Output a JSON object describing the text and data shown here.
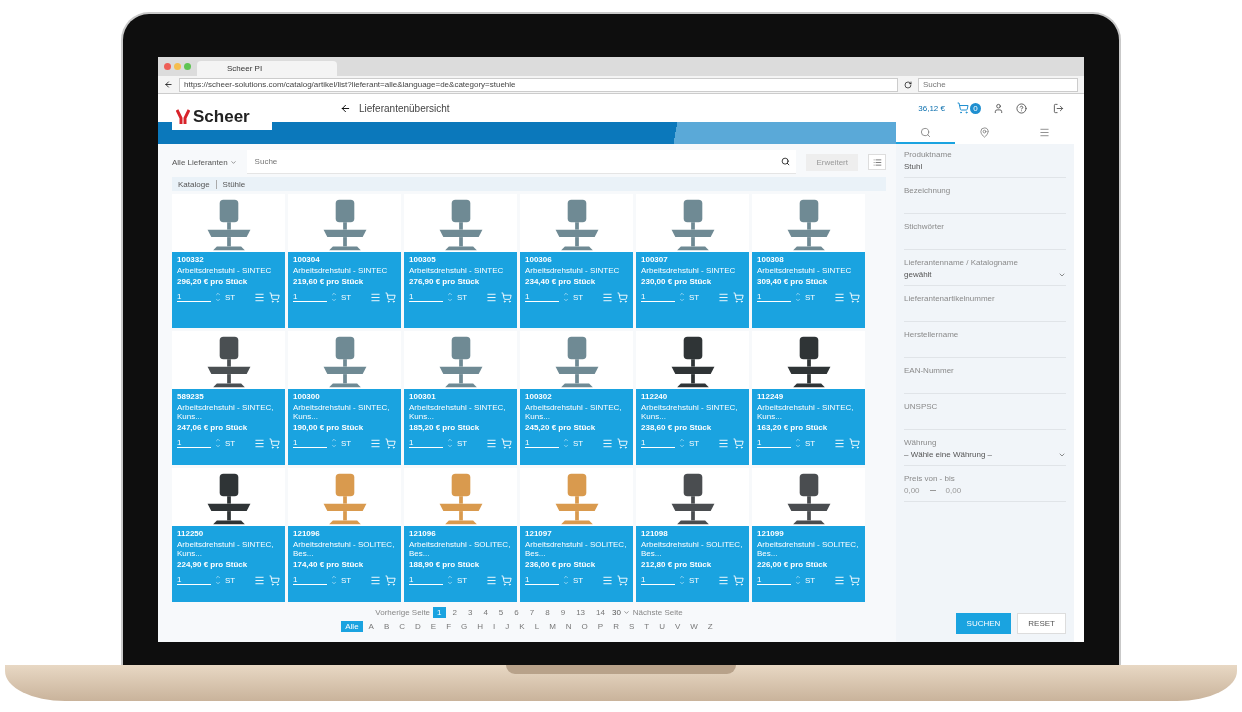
{
  "browser": {
    "tab_title": "Scheer PI",
    "url": "https://scheer-solutions.com/catalog/artikel/list?lieferant=alle&language=de&category=stuehle",
    "search_placeholder": "Suche"
  },
  "header": {
    "logo": "Scheer",
    "title": "Lieferantenübersicht",
    "cart_total": "36,12 €",
    "cart_count": "0"
  },
  "toolbar": {
    "supplier_filter": "Alle Lieferanten",
    "search_placeholder": "Suche",
    "action": "Erweitert"
  },
  "breadcrumb": [
    "Kataloge",
    "Stühle"
  ],
  "products": [
    {
      "id": "100332",
      "name": "Arbeitsdrehstuhl - SINTEC",
      "price": "296,20 € pro Stück",
      "qty": "1",
      "unit": "ST",
      "color": "#6f8a94"
    },
    {
      "id": "100304",
      "name": "Arbeitsdrehstuhl - SINTEC",
      "price": "219,60 € pro Stück",
      "qty": "1",
      "unit": "ST",
      "color": "#6f8a94"
    },
    {
      "id": "100305",
      "name": "Arbeitsdrehstuhl - SINTEC",
      "price": "276,90 € pro Stück",
      "qty": "1",
      "unit": "ST",
      "color": "#6f8a94"
    },
    {
      "id": "100306",
      "name": "Arbeitsdrehstuhl - SINTEC",
      "price": "234,40 € pro Stück",
      "qty": "1",
      "unit": "ST",
      "color": "#6f8a94"
    },
    {
      "id": "100307",
      "name": "Arbeitsdrehstuhl - SINTEC",
      "price": "230,00 € pro Stück",
      "qty": "1",
      "unit": "ST",
      "color": "#6f8a94"
    },
    {
      "id": "100308",
      "name": "Arbeitsdrehstuhl - SINTEC",
      "price": "309,40 € pro Stück",
      "qty": "1",
      "unit": "ST",
      "color": "#6f8a94"
    },
    {
      "id": "589235",
      "name": "Arbeitsdrehstuhl - SINTEC, Kuns...",
      "price": "247,06 € pro Stück",
      "qty": "1",
      "unit": "ST",
      "color": "#4a4f52"
    },
    {
      "id": "100300",
      "name": "Arbeitsdrehstuhl - SINTEC, Kuns...",
      "price": "190,00 € pro Stück",
      "qty": "1",
      "unit": "ST",
      "color": "#6f8a94"
    },
    {
      "id": "100301",
      "name": "Arbeitsdrehstuhl - SINTEC, Kuns...",
      "price": "185,20 € pro Stück",
      "qty": "1",
      "unit": "ST",
      "color": "#6f8a94"
    },
    {
      "id": "100302",
      "name": "Arbeitsdrehstuhl - SINTEC, Kuns...",
      "price": "245,20 € pro Stück",
      "qty": "1",
      "unit": "ST",
      "color": "#6f8a94"
    },
    {
      "id": "112240",
      "name": "Arbeitsdrehstuhl - SINTEC, Kuns...",
      "price": "238,60 € pro Stück",
      "qty": "1",
      "unit": "ST",
      "color": "#2f3436"
    },
    {
      "id": "112249",
      "name": "Arbeitsdrehstuhl - SINTEC, Kuns...",
      "price": "163,20 € pro Stück",
      "qty": "1",
      "unit": "ST",
      "color": "#2f3436"
    },
    {
      "id": "112250",
      "name": "Arbeitsdrehstuhl - SINTEC, Kuns...",
      "price": "224,90 € pro Stück",
      "qty": "1",
      "unit": "ST",
      "color": "#2f3436"
    },
    {
      "id": "121096",
      "name": "Arbeitsdrehstuhl - SOLITEC, Bes...",
      "price": "174,40 € pro Stück",
      "qty": "1",
      "unit": "ST",
      "color": "#d99a4e"
    },
    {
      "id": "121096",
      "name": "Arbeitsdrehstuhl - SOLITEC, Bes...",
      "price": "188,90 € pro Stück",
      "qty": "1",
      "unit": "ST",
      "color": "#d99a4e"
    },
    {
      "id": "121097",
      "name": "Arbeitsdrehstuhl - SOLITEC, Bes...",
      "price": "236,00 € pro Stück",
      "qty": "1",
      "unit": "ST",
      "color": "#d99a4e"
    },
    {
      "id": "121098",
      "name": "Arbeitsdrehstuhl - SOLITEC, Bes...",
      "price": "212,80 € pro Stück",
      "qty": "1",
      "unit": "ST",
      "color": "#4a4d50"
    },
    {
      "id": "121099",
      "name": "Arbeitsdrehstuhl - SOLITEC, Bes...",
      "price": "226,00 € pro Stück",
      "qty": "1",
      "unit": "ST",
      "color": "#4a4d50"
    }
  ],
  "pagination": {
    "prev": "Vorherige Seite",
    "pages": [
      {
        "label": "1",
        "selected": true
      },
      {
        "label": "2",
        "selected": false
      },
      {
        "label": "3",
        "selected": false
      },
      {
        "label": "4",
        "selected": false
      },
      {
        "label": "5",
        "selected": false
      },
      {
        "label": "6",
        "selected": false
      },
      {
        "label": "7",
        "selected": false
      },
      {
        "label": "8",
        "selected": false
      },
      {
        "label": "9",
        "selected": false
      },
      {
        "label": "13",
        "selected": false
      },
      {
        "label": "14",
        "selected": false
      }
    ],
    "per_page": "30",
    "next": "Nächste Seite"
  },
  "letters": [
    {
      "label": "Alle",
      "selected": true
    },
    {
      "label": "A",
      "selected": false
    },
    {
      "label": "B",
      "selected": false
    },
    {
      "label": "C",
      "selected": false
    },
    {
      "label": "D",
      "selected": false
    },
    {
      "label": "E",
      "selected": false
    },
    {
      "label": "F",
      "selected": false
    },
    {
      "label": "G",
      "selected": false
    },
    {
      "label": "H",
      "selected": false
    },
    {
      "label": "I",
      "selected": false
    },
    {
      "label": "J",
      "selected": false
    },
    {
      "label": "K",
      "selected": false
    },
    {
      "label": "L",
      "selected": false
    },
    {
      "label": "M",
      "selected": false
    },
    {
      "label": "N",
      "selected": false
    },
    {
      "label": "O",
      "selected": false
    },
    {
      "label": "P",
      "selected": false
    },
    {
      "label": "R",
      "selected": false
    },
    {
      "label": "S",
      "selected": false
    },
    {
      "label": "T",
      "selected": false
    },
    {
      "label": "U",
      "selected": false
    },
    {
      "label": "V",
      "selected": false
    },
    {
      "label": "W",
      "selected": false
    },
    {
      "label": "Z",
      "selected": false
    }
  ],
  "sidebar": {
    "tabs": [
      {
        "kind": "search",
        "selected": true
      },
      {
        "kind": "pin",
        "selected": false
      },
      {
        "kind": "list",
        "selected": false
      }
    ],
    "fields": [
      {
        "kind": "text",
        "label": "Produktname",
        "value": "Stuhl"
      },
      {
        "kind": "text",
        "label": "Bezeichnung"
      },
      {
        "kind": "text",
        "label": "Stichwörter"
      },
      {
        "kind": "select",
        "label": "Lieferantenname / Katalogname",
        "value": "gewählt"
      },
      {
        "kind": "text",
        "label": "Lieferantenartikelnummer"
      },
      {
        "kind": "text",
        "label": "Herstellername"
      },
      {
        "kind": "text",
        "label": "EAN-Nummer"
      },
      {
        "kind": "text",
        "label": "UNSPSC"
      },
      {
        "kind": "select",
        "label": "Währung",
        "value": "– Wähle eine Währung –"
      },
      {
        "kind": "range",
        "label": "Preis von - bis",
        "from": "0,00",
        "to": "0,00"
      }
    ],
    "buttons": [
      {
        "label": "SUCHEN",
        "kind": "primary"
      },
      {
        "label": "RESET",
        "kind": "secondary"
      }
    ]
  }
}
